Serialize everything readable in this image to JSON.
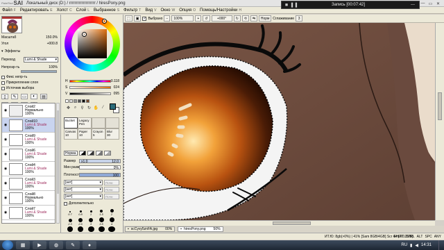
{
  "window": {
    "logo_small": "PaintTool",
    "logo_big": "SAI",
    "title": "Локальный диск (D:) / rrrrrrrrrrrrrrrrrrr / hiresPony.png"
  },
  "recorder": {
    "label": "Запись [00:07:42]",
    "minimize": "—"
  },
  "window_buttons": [
    "—",
    "▭",
    "✕"
  ],
  "menu": [
    {
      "label": "Файл",
      "key": "F"
    },
    {
      "label": "Редактировать",
      "key": "E"
    },
    {
      "label": "Холст",
      "key": "C"
    },
    {
      "label": "Слой",
      "key": "L"
    },
    {
      "label": "Выбранное",
      "key": "S"
    },
    {
      "label": "Фильтр",
      "key": "T"
    },
    {
      "label": "Вид",
      "key": "V"
    },
    {
      "label": "Окно",
      "key": "W"
    },
    {
      "label": "Опция",
      "key": "O"
    },
    {
      "label": "Помощь/Настройки",
      "key": "H"
    }
  ],
  "toolbar": {
    "selection_label": "Выбрано",
    "zoom": "100%",
    "rotation": "+000°",
    "mode": "Норм",
    "stabilizer_label": "Сглаживание",
    "stabilizer_value": "3"
  },
  "navigator": {
    "zoom_label": "Масштаб",
    "zoom_value": "150.0%",
    "angle_label": "Угол",
    "angle_value": "+000.8"
  },
  "layer_props": {
    "effects_label": "Эффекты",
    "blend_label": "Переход",
    "blend_value": "Lumi & Shade",
    "opacity_label": "Непрозр-ть",
    "opacity_value": "100%",
    "opacity": 1.0,
    "protect_label": "Фикс непр-ть",
    "clip_label": "Прикрепление слоя",
    "source_label": "Источник выбора"
  },
  "layers": [
    {
      "name": "Слой2",
      "mode": "Нормально",
      "opacity": "100%",
      "selected": false
    },
    {
      "name": "Слой10",
      "mode": "Lumi & Shade",
      "opacity": "100%",
      "selected": true
    },
    {
      "name": "Слой9",
      "mode": "Lumi & Shade",
      "opacity": "100%",
      "selected": false
    },
    {
      "name": "Слой6",
      "mode": "Lumi & Shade",
      "opacity": "100%",
      "selected": false
    },
    {
      "name": "Слой4",
      "mode": "Lumi & Shade",
      "opacity": "100%",
      "selected": false
    },
    {
      "name": "Слой3",
      "mode": "Lumi & Shade",
      "opacity": "100%",
      "selected": false
    },
    {
      "name": "Слой8",
      "mode": "Нормально",
      "opacity": "100%",
      "selected": false
    },
    {
      "name": "Слой7",
      "mode": "Lumi & Shade",
      "opacity": "100%",
      "selected": false
    }
  ],
  "color": {
    "h_label": "H",
    "h_value": "0.118",
    "s_label": "S",
    "s_value": "024",
    "v_label": "V",
    "v_value": "095",
    "h_fraction": 0.118,
    "s_fraction": 0.24,
    "v_fraction": 0.95,
    "foreground": "#2b6b78",
    "background": "#ffffff"
  },
  "brushes": [
    {
      "name": "Bucket",
      "size": "",
      "selected": true
    },
    {
      "name": "Legacy Pen",
      "size": "",
      "selected": false
    },
    {
      "name": "",
      "size": "",
      "selected": false
    },
    {
      "name": "",
      "size": "",
      "selected": false
    },
    {
      "name": "Canvas",
      "size": "10",
      "selected": false
    },
    {
      "name": "Paper",
      "size": "10",
      "selected": false
    },
    {
      "name": "Crayon",
      "size": "5",
      "selected": false
    },
    {
      "name": "Blur",
      "size": "30",
      "selected": false
    }
  ],
  "brush_options": {
    "mode_label": "Норма",
    "size_label": "Размер",
    "size_multiplier": "x1.0",
    "size_value": "12.0",
    "min_size_label": "Мин размер",
    "min_size_value": "0%",
    "density_label": "Плотность",
    "density_value": "100",
    "texture_1": "[нет]",
    "texture_1_value": "Почн",
    "texture_2": "[нет]",
    "texture_2_value": "Почн",
    "texture_3": "[нет]",
    "texture_3_value": "Почн",
    "advanced_label": "Дополнительно"
  },
  "brush_sizes": [
    "0.7",
    "0.8",
    "1",
    "1.5",
    "2",
    "2.3",
    "2.6",
    "3",
    "3.5",
    "4",
    "5",
    "6",
    "7",
    "8",
    "9"
  ],
  "doc_tabs": [
    {
      "name": "scCyvy5znFA.jpg",
      "zoom": "00%",
      "active": false
    },
    {
      "name": "hiresPony.png",
      "zoom": "50%",
      "active": true
    }
  ],
  "status": {
    "memory": "ИТ.Ю: 8gb(>0%) | 41% [Sam 8GB/4GB] Scr 44 (2012MB)",
    "keys": [
      "SHIFT",
      "CTRL",
      "ALT",
      "SPC",
      "ANY"
    ]
  },
  "taskbar": {
    "lang": "RU",
    "time": "14:31"
  },
  "canvas_colors": {
    "skin": "#6b4a3d",
    "mane_light": "#eadccb",
    "eye_white": "#f4f4f4",
    "iris_dark": "#3a1a08",
    "iris_orange": "#d86a10",
    "iris_highlight": "#ffe9b0"
  }
}
